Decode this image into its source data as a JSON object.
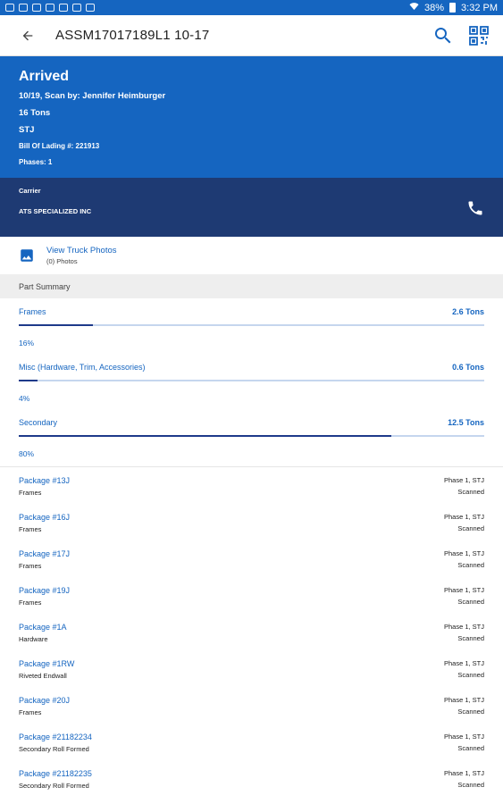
{
  "status_bar": {
    "battery": "38%",
    "time": "3:32 PM"
  },
  "app_bar": {
    "title": "ASSM17017189L1 10-17",
    "back_icon": "arrow-left-icon",
    "search_icon": "search-icon",
    "qr_icon": "qr-code-icon"
  },
  "hero": {
    "status": "Arrived",
    "scan": "10/19, Scan by: Jennifer Heimburger",
    "weight": "16 Tons",
    "location": "STJ",
    "bill_of_lading": "Bill Of Lading #: 221913",
    "phase": "Phases: 1"
  },
  "carrier": {
    "label": "Carrier",
    "name": "ATS SPECIALIZED INC",
    "phone_icon": "phone-icon"
  },
  "photos": {
    "title": "View Truck Photos",
    "count": "(0) Photos",
    "icon": "image-icon"
  },
  "part_summary": {
    "header": "Part Summary",
    "items": [
      {
        "name": "Frames",
        "tons": "2.6 Tons",
        "percent_label": "16%",
        "percent": 16
      },
      {
        "name": "Misc (Hardware, Trim, Accessories)",
        "tons": "0.6 Tons",
        "percent_label": "4%",
        "percent": 4
      },
      {
        "name": "Secondary",
        "tons": "12.5 Tons",
        "percent_label": "80%",
        "percent": 80
      }
    ]
  },
  "packages": [
    {
      "name": "Package #13J",
      "type": "Frames",
      "phase": "Phase 1, STJ",
      "status": "Scanned"
    },
    {
      "name": "Package #16J",
      "type": "Frames",
      "phase": "Phase 1, STJ",
      "status": "Scanned"
    },
    {
      "name": "Package #17J",
      "type": "Frames",
      "phase": "Phase 1, STJ",
      "status": "Scanned"
    },
    {
      "name": "Package #19J",
      "type": "Frames",
      "phase": "Phase 1, STJ",
      "status": "Scanned"
    },
    {
      "name": "Package #1A",
      "type": "Hardware",
      "phase": "Phase 1, STJ",
      "status": "Scanned"
    },
    {
      "name": "Package #1RW",
      "type": "Riveted Endwall",
      "phase": "Phase 1, STJ",
      "status": "Scanned"
    },
    {
      "name": "Package #20J",
      "type": "Frames",
      "phase": "Phase 1, STJ",
      "status": "Scanned"
    },
    {
      "name": "Package #21182234",
      "type": "Secondary Roll Formed",
      "phase": "Phase 1, STJ",
      "status": "Scanned"
    },
    {
      "name": "Package #21182235",
      "type": "Secondary Roll Formed",
      "phase": "Phase 1, STJ",
      "status": "Scanned"
    }
  ],
  "colors": {
    "primary": "#1565c0",
    "carrier_bg": "#1e3a73",
    "progress_fill": "#1e3a8a",
    "progress_track": "#c5d6ee"
  }
}
